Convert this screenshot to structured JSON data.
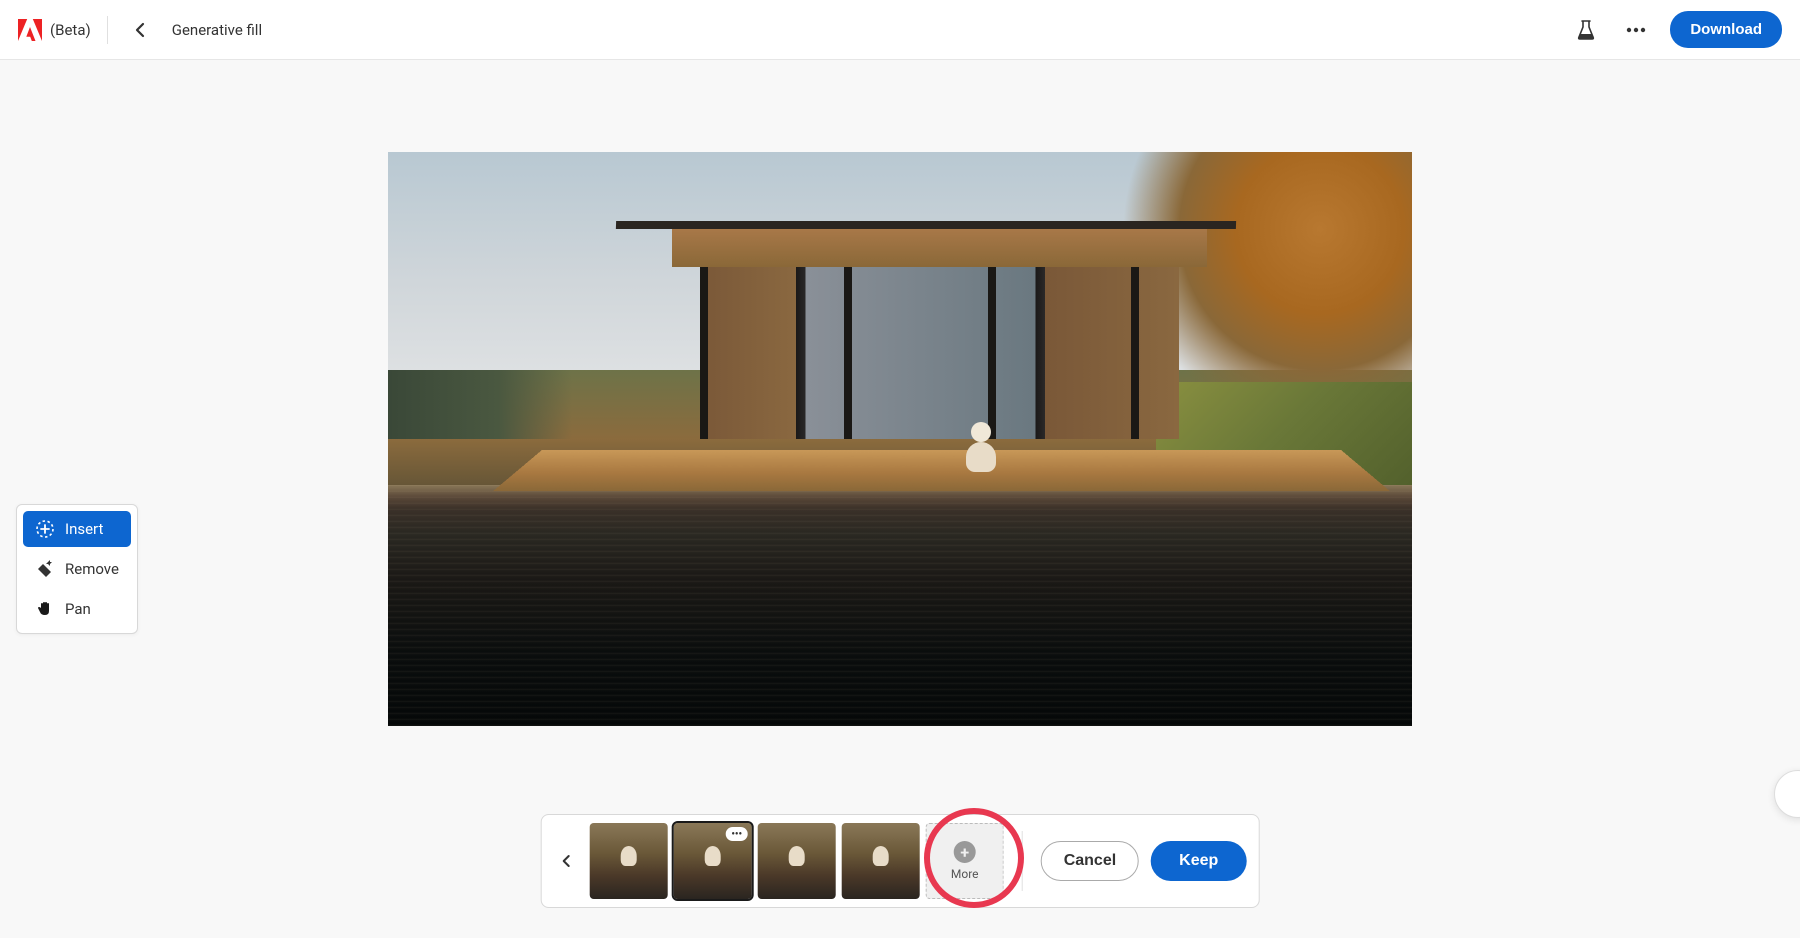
{
  "header": {
    "logo_text": "(Beta)",
    "page_title": "Generative fill",
    "download_label": "Download"
  },
  "toolbox": {
    "items": [
      {
        "label": "Insert",
        "icon": "insert-icon",
        "active": true
      },
      {
        "label": "Remove",
        "icon": "remove-icon",
        "active": false
      },
      {
        "label": "Pan",
        "icon": "pan-icon",
        "active": false
      }
    ]
  },
  "bottom_panel": {
    "more_label": "More",
    "cancel_label": "Cancel",
    "keep_label": "Keep",
    "thumbnail_count": 4,
    "selected_index": 1
  },
  "colors": {
    "primary": "#0d66d0",
    "annotation": "#e83850"
  }
}
